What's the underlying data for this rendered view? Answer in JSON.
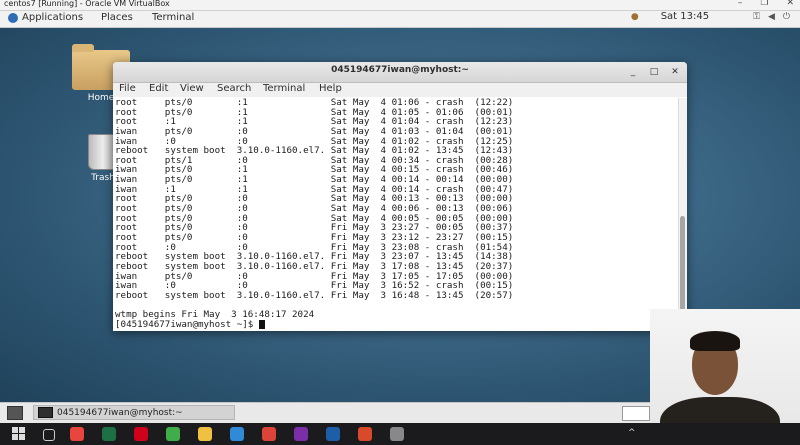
{
  "vbox": {
    "title": "centos7 [Running] - Oracle VM VirtualBox"
  },
  "panel": {
    "applications": "Applications",
    "places": "Places",
    "terminal": "Terminal",
    "clock": "Sat 13:45"
  },
  "desktop": {
    "home_label": "Home",
    "trash_label": "Trash"
  },
  "terminal": {
    "title": "045194677iwan@myhost:~",
    "menu": [
      "File",
      "Edit",
      "View",
      "Search",
      "Terminal",
      "Help"
    ],
    "lines": [
      "root     pts/0        :1               Sat May  4 01:06 - crash  (12:22)",
      "root     pts/0        :1               Sat May  4 01:05 - 01:06  (00:01)",
      "root     :1           :1               Sat May  4 01:04 - crash  (12:23)",
      "iwan     pts/0        :0               Sat May  4 01:03 - 01:04  (00:01)",
      "iwan     :0           :0               Sat May  4 01:02 - crash  (12:25)",
      "reboot   system boot  3.10.0-1160.el7. Sat May  4 01:02 - 13:45  (12:43)",
      "root     pts/1        :0               Sat May  4 00:34 - crash  (00:28)",
      "iwan     pts/0        :1               Sat May  4 00:15 - crash  (00:46)",
      "iwan     pts/0        :1               Sat May  4 00:14 - 00:14  (00:00)",
      "iwan     :1           :1               Sat May  4 00:14 - crash  (00:47)",
      "root     pts/0        :0               Sat May  4 00:13 - 00:13  (00:00)",
      "root     pts/0        :0               Sat May  4 00:06 - 00:13  (00:06)",
      "root     pts/0        :0               Sat May  4 00:05 - 00:05  (00:00)",
      "root     pts/0        :0               Fri May  3 23:27 - 00:05  (00:37)",
      "root     pts/0        :0               Fri May  3 23:12 - 23:27  (00:15)",
      "root     :0           :0               Fri May  3 23:08 - crash  (01:54)",
      "reboot   system boot  3.10.0-1160.el7. Fri May  3 23:07 - 13:45  (14:38)",
      "reboot   system boot  3.10.0-1160.el7. Fri May  3 17:08 - 13:45  (20:37)",
      "iwan     pts/0        :0               Fri May  3 17:05 - 17:05  (00:00)",
      "iwan     :0           :0               Fri May  3 16:52 - crash  (00:15)",
      "reboot   system boot  3.10.0-1160.el7. Fri May  3 16:48 - 13:45  (20:57)",
      "",
      "wtmp begins Fri May  3 16:48:17 2024"
    ],
    "prompt": "[045194677iwan@myhost ~]$ "
  },
  "windowlist": {
    "task_label": "045194677iwan@myhost:~"
  },
  "taskbar": {
    "apps": [
      {
        "icon": "chrome-icon",
        "color": "#e8453c"
      },
      {
        "icon": "excel-icon",
        "color": "#1d7044"
      },
      {
        "icon": "opera-icon",
        "color": "#d0021b"
      },
      {
        "icon": "camtasia-icon",
        "color": "#3fae49"
      },
      {
        "icon": "folder-icon",
        "color": "#f0c040"
      },
      {
        "icon": "edge-icon",
        "color": "#2f8ad8"
      },
      {
        "icon": "chrome-app-icon",
        "color": "#db4437"
      },
      {
        "icon": "video-icon",
        "color": "#7a2fa8"
      },
      {
        "icon": "virtualbox-icon",
        "color": "#1c5ea8"
      },
      {
        "icon": "screen-recorder-icon",
        "color": "#d84a2a"
      },
      {
        "icon": "snipping-icon",
        "color": "#888888"
      }
    ]
  }
}
